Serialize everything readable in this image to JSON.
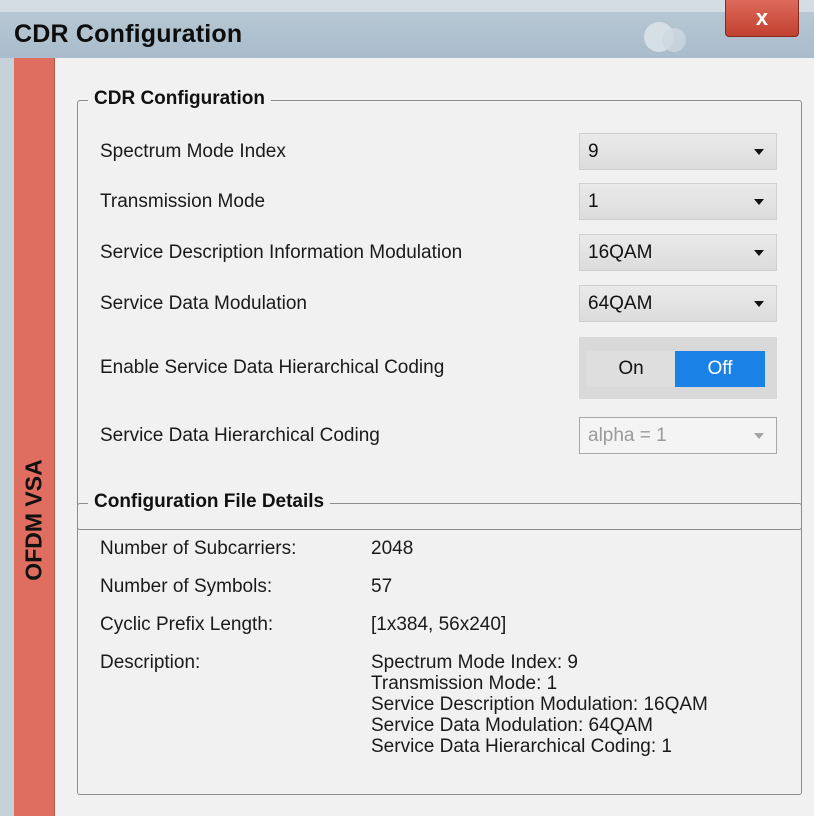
{
  "window": {
    "title": "CDR Configuration",
    "close_glyph": "x",
    "side_tab": "OFDM VSA"
  },
  "cdr_group": {
    "title": "CDR Configuration",
    "rows": [
      {
        "label": "Spectrum Mode Index",
        "value": "9"
      },
      {
        "label": "Transmission Mode",
        "value": "1"
      },
      {
        "label": "Service Description Information Modulation",
        "value": "16QAM"
      },
      {
        "label": "Service Data Modulation",
        "value": "64QAM"
      }
    ],
    "hier_enable": {
      "label": "Enable Service Data Hierarchical Coding",
      "on": "On",
      "off": "Off",
      "state": "Off"
    },
    "hier_coding": {
      "label": "Service Data Hierarchical Coding",
      "value": "alpha = 1",
      "disabled": true
    }
  },
  "file_group": {
    "title": "Configuration File Details",
    "details": [
      {
        "label": "Number of Subcarriers:",
        "value": "2048"
      },
      {
        "label": "Number of Symbols:",
        "value": "57"
      },
      {
        "label": "Cyclic Prefix Length:",
        "value": "[1x384, 56x240]"
      }
    ],
    "description_label": "Description:",
    "description_lines": [
      "Spectrum Mode Index: 9",
      "Transmission Mode: 1",
      "Service Description Modulation: 16QAM",
      "Service Data Modulation: 64QAM",
      "Service Data Hierarchical Coding: 1"
    ]
  },
  "colors": {
    "side_tab": "#e06e60",
    "toggle_active": "#1a82e6",
    "close_button": "#c94a3a"
  }
}
